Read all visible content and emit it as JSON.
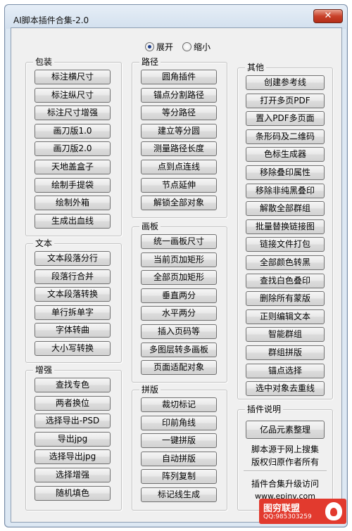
{
  "window": {
    "title": "AI脚本插件合集-2.0",
    "close_symbol": "✕"
  },
  "mode": {
    "expand": "展开",
    "shrink": "缩小",
    "selected": "展开"
  },
  "groups": {
    "packaging": {
      "title": "包装",
      "buttons": [
        "标注横尺寸",
        "标注纵尺寸",
        "标注尺寸增强",
        "画刀版1.0",
        "画刀版2.0",
        "天地盖盒子",
        "绘制手提袋",
        "绘制外箱",
        "生成出血线"
      ]
    },
    "text": {
      "title": "文本",
      "buttons": [
        "文本段落分行",
        "段落行合并",
        "文本段落转换",
        "单行拆单字",
        "字体转曲",
        "大小写转换"
      ]
    },
    "enhance": {
      "title": "增强",
      "buttons": [
        "查找专色",
        "两者换位",
        "选择导出-PSD",
        "导出jpg",
        "选择导出jpg",
        "选择增强",
        "随机填色"
      ]
    },
    "path": {
      "title": "路径",
      "buttons": [
        "圆角插件",
        "锚点分割路径",
        "等分路径",
        "建立等分圆",
        "测量路径长度",
        "点到点连线",
        "节点延伸",
        "解锁全部对象"
      ]
    },
    "artboard": {
      "title": "画板",
      "buttons": [
        "统一画板尺寸",
        "当前页加矩形",
        "全部页加矩形",
        "垂直两分",
        "水平两分",
        "插入页码等",
        "多图层转多画板",
        "页面适配对象"
      ]
    },
    "imposition": {
      "title": "拼版",
      "buttons": [
        "裁切标记",
        "印前角线",
        "一键拼版",
        "自动拼版",
        "阵列复制",
        "标记线生成"
      ]
    },
    "other": {
      "title": "其他",
      "buttons": [
        "创建参考线",
        "打开多页PDF",
        "置入PDF多页面",
        "条形码及二维码",
        "色标生成器",
        "移除叠印属性",
        "移除非纯黑叠印",
        "解散全部群组",
        "批量替换链接图",
        "链接文件打包",
        "全部颜色转黑",
        "查找白色叠印",
        "删除所有蒙版",
        "正则编辑文本",
        "智能群组",
        "群组拼版",
        "锚点选择",
        "选中对象去重线"
      ]
    },
    "info": {
      "title": "插件说明",
      "button": "亿品元素整理",
      "line1": "脚本源于网上搜集",
      "line2": "版权归原作者所有",
      "line3": "插件合集升级访问",
      "url": "www.epinv.com"
    }
  },
  "watermark": {
    "title": "图穷联盟",
    "subtitle": "QQ:985303259",
    "brand_color": "#e23a2e"
  }
}
